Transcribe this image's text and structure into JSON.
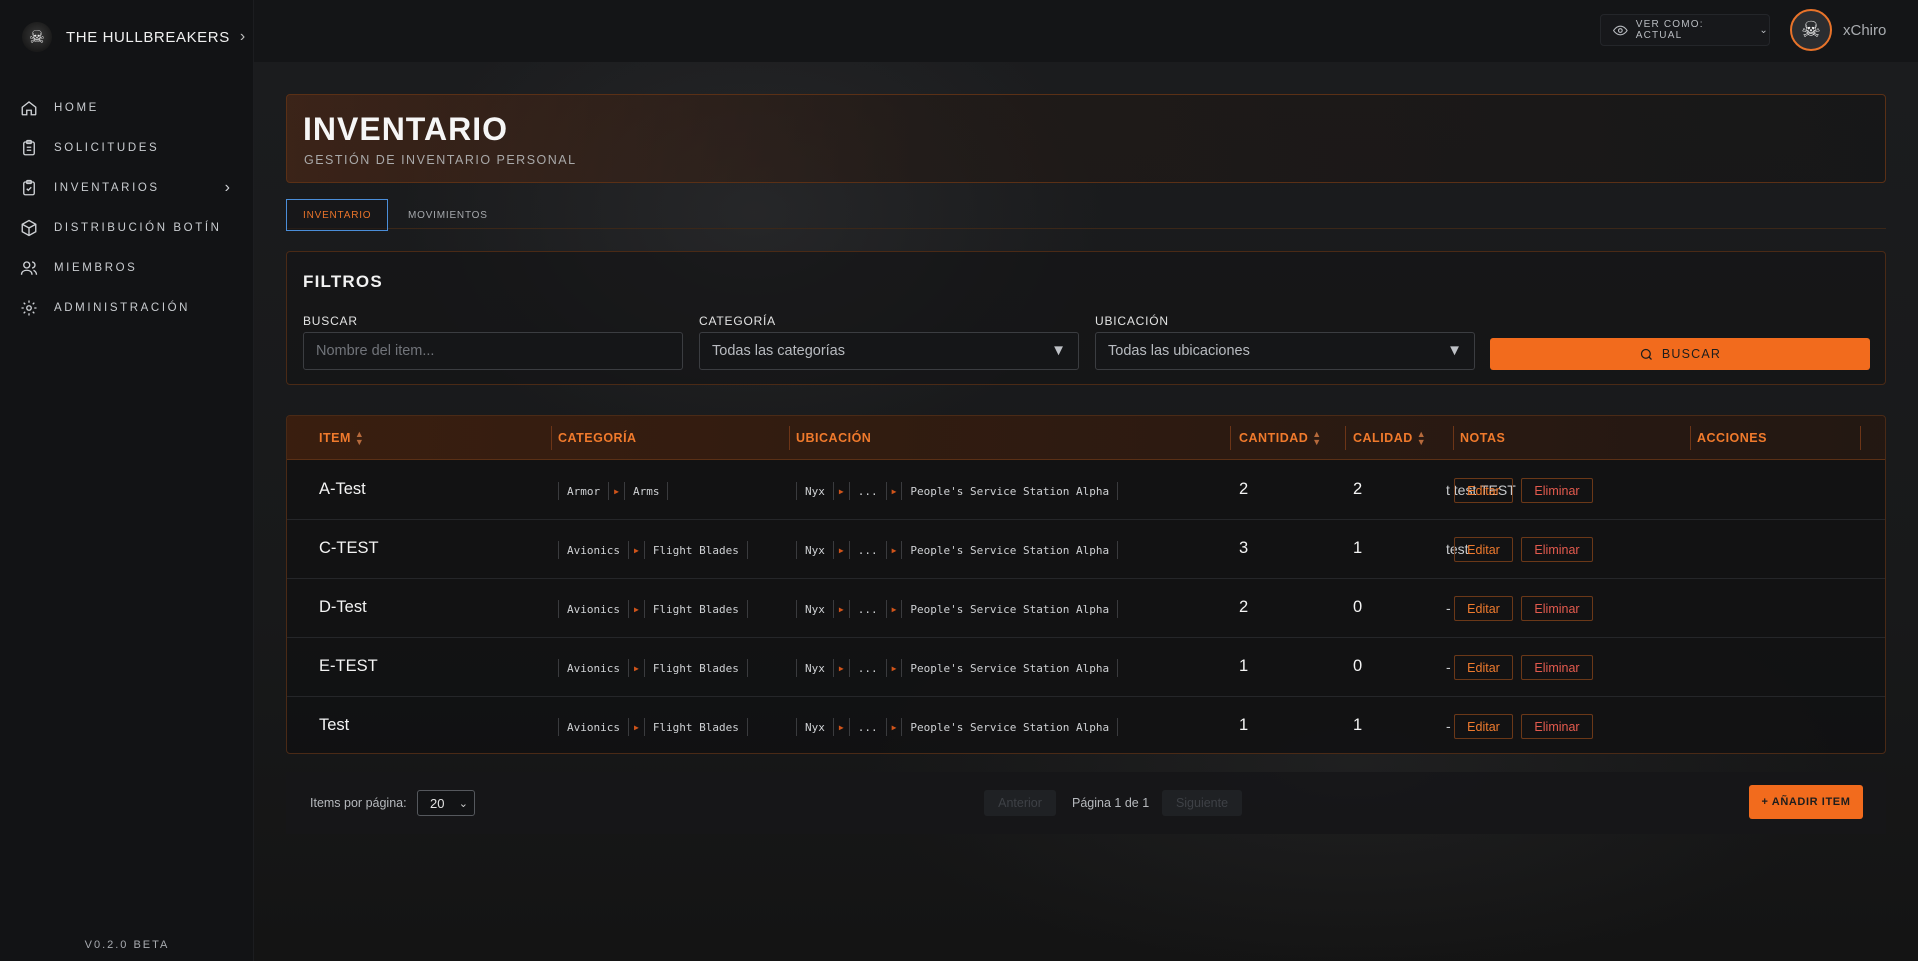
{
  "brand": {
    "name": "THE HULLBREAKERS",
    "logo_icon": "skull-icon"
  },
  "nav": {
    "items": [
      {
        "label": "HOME",
        "icon": "home-icon"
      },
      {
        "label": "SOLICITUDES",
        "icon": "clipboard-icon"
      },
      {
        "label": "INVENTARIOS",
        "icon": "clipboard-check-icon",
        "has_submenu": true
      },
      {
        "label": "DISTRIBUCIÓN BOTÍN",
        "icon": "box-icon"
      },
      {
        "label": "MIEMBROS",
        "icon": "users-icon"
      },
      {
        "label": "ADMINISTRACIÓN",
        "icon": "gear-icon"
      }
    ]
  },
  "version": "V0.2.0 BETA",
  "topbar": {
    "view_as": "VER COMO: ACTUAL",
    "username": "xChiro"
  },
  "header": {
    "title": "INVENTARIO",
    "subtitle": "GESTIÓN DE INVENTARIO PERSONAL"
  },
  "tabs": [
    {
      "label": "INVENTARIO",
      "active": true
    },
    {
      "label": "MOVIMIENTOS",
      "active": false
    }
  ],
  "filters": {
    "title": "FILTROS",
    "search_label": "BUSCAR",
    "search_placeholder": "Nombre del item...",
    "category_label": "CATEGORÍA",
    "category_value": "Todas las categorías",
    "location_label": "UBICACIÓN",
    "location_value": "Todas las ubicaciones",
    "search_button": "BUSCAR"
  },
  "table": {
    "columns": [
      "ITEM",
      "CATEGORÍA",
      "UBICACIÓN",
      "CANTIDAD",
      "CALIDAD",
      "NOTAS",
      "ACCIONES"
    ],
    "rows": [
      {
        "item": "A-Test",
        "category": [
          "Armor",
          "Arms"
        ],
        "location": [
          "Nyx",
          "...",
          "People's Service Station Alpha"
        ],
        "quantity": "2",
        "quality": "2",
        "notes": "t test TEST"
      },
      {
        "item": "C-TEST",
        "category": [
          "Avionics",
          "Flight Blades"
        ],
        "location": [
          "Nyx",
          "...",
          "People's Service Station Alpha"
        ],
        "quantity": "3",
        "quality": "1",
        "notes": "test"
      },
      {
        "item": "D-Test",
        "category": [
          "Avionics",
          "Flight Blades"
        ],
        "location": [
          "Nyx",
          "...",
          "People's Service Station Alpha"
        ],
        "quantity": "2",
        "quality": "0",
        "notes": "-"
      },
      {
        "item": "E-TEST",
        "category": [
          "Avionics",
          "Flight Blades"
        ],
        "location": [
          "Nyx",
          "...",
          "People's Service Station Alpha"
        ],
        "quantity": "1",
        "quality": "0",
        "notes": "-"
      },
      {
        "item": "Test",
        "category": [
          "Avionics",
          "Flight Blades"
        ],
        "location": [
          "Nyx",
          "...",
          "People's Service Station Alpha"
        ],
        "quantity": "1",
        "quality": "1",
        "notes": "-"
      }
    ],
    "edit_label": "Editar",
    "delete_label": "Eliminar"
  },
  "pagination": {
    "per_page_label": "Items por página:",
    "per_page_value": "20",
    "prev_label": "Anterior",
    "page_info": "Página 1 de 1",
    "next_label": "Siguiente",
    "add_button": "+ AÑADIR ITEM"
  },
  "colors": {
    "accent": "#f26b1d",
    "header_text": "#f07a2c",
    "danger": "#e35a4e",
    "tab_active_border": "#4b8ed9"
  }
}
